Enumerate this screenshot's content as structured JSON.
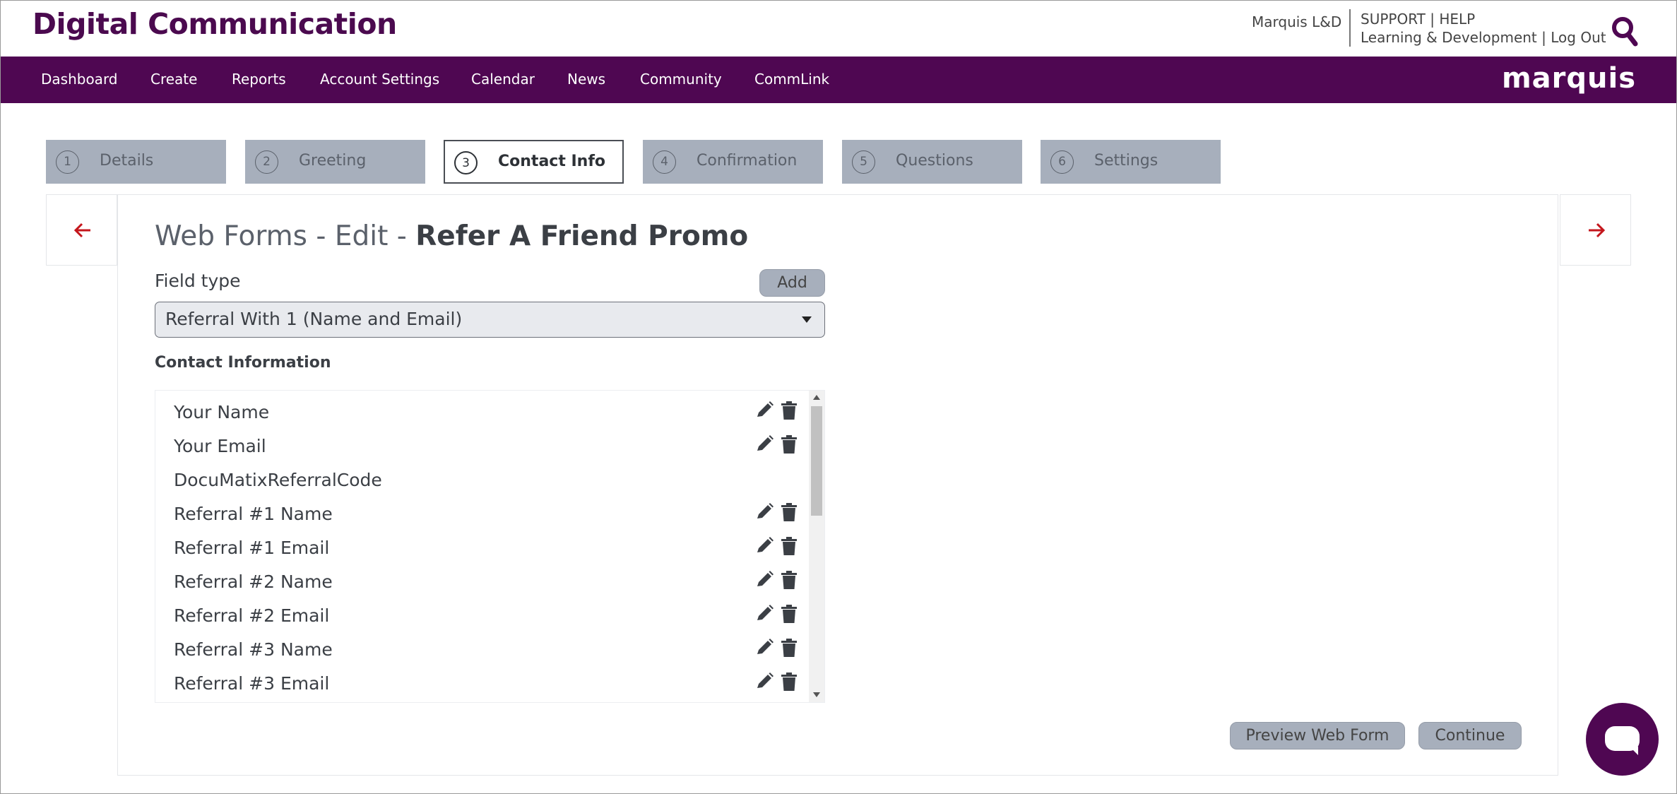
{
  "header": {
    "brand": "Digital Communication",
    "user_name": "Marquis L&D",
    "support": "SUPPORT",
    "help": "HELP",
    "learning": "Learning & Development",
    "logout": "Log Out",
    "separator": "|",
    "search_icon": "search-icon"
  },
  "nav": {
    "items": [
      "Dashboard",
      "Create",
      "Reports",
      "Account Settings",
      "Calendar",
      "News",
      "Community",
      "CommLink"
    ],
    "logo": "marquis",
    "background": "#4f0752"
  },
  "steps": [
    {
      "number": "1",
      "label": "Details"
    },
    {
      "number": "2",
      "label": "Greeting"
    },
    {
      "number": "3",
      "label": "Contact Info",
      "active": true
    },
    {
      "number": "4",
      "label": "Confirmation"
    },
    {
      "number": "5",
      "label": "Questions"
    },
    {
      "number": "6",
      "label": "Settings"
    }
  ],
  "page": {
    "title_prefix": "Web Forms - Edit - ",
    "title_name": "Refer A Friend Promo",
    "field_type_label": "Field type",
    "add_label": "Add",
    "select_value": "Referral With 1 (Name and Email)",
    "section_heading": "Contact Information",
    "fields": [
      {
        "label": "Your Name",
        "editable": true
      },
      {
        "label": "Your Email",
        "editable": true
      },
      {
        "label": "DocuMatixReferralCode",
        "editable": false
      },
      {
        "label": "Referral #1 Name",
        "editable": true
      },
      {
        "label": "Referral #1 Email",
        "editable": true
      },
      {
        "label": "Referral #2 Name",
        "editable": true
      },
      {
        "label": "Referral #2 Email",
        "editable": true
      },
      {
        "label": "Referral #3 Name",
        "editable": true
      },
      {
        "label": "Referral #3 Email",
        "editable": true
      }
    ],
    "preview_label": "Preview Web Form",
    "continue_label": "Continue"
  },
  "colors": {
    "brand_purple": "#4f0752",
    "arrow_red": "#c4161c",
    "step_gray": "#a7afbc"
  }
}
